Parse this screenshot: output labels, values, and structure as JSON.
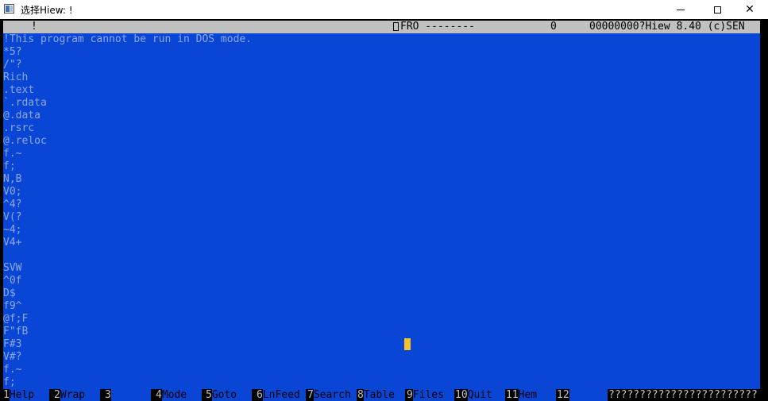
{
  "window": {
    "title": "选择Hiew: !",
    "minimize_glyph": "",
    "maximize_glyph": "",
    "close_glyph": "✕"
  },
  "status": {
    "marker": "!",
    "mode": "FRO --------",
    "offset_col": "0",
    "address_info": "00000000?Hiew 8.40 (c)SEN"
  },
  "content": {
    "lines": [
      "!This program cannot be run in DOS mode.",
      "*5?",
      "/\"?",
      "Rich",
      ".text",
      "`.rdata",
      "@.data",
      ".rsrc",
      "@.reloc",
      "f.~",
      "f;",
      "N,B",
      "V0;",
      "^4?",
      "V(?",
      "~4;",
      "V4+",
      "",
      "SVW",
      "^0f",
      "D$",
      "f9^",
      "@f;F",
      "F\"fB",
      "F#3",
      "V#?",
      "f.~",
      "f;"
    ]
  },
  "fkeys": [
    {
      "num": "1",
      "label": "Help"
    },
    {
      "num": "2",
      "label": "Wrap"
    },
    {
      "num": "3",
      "label": ""
    },
    {
      "num": "4",
      "label": "Mode"
    },
    {
      "num": "5",
      "label": "Goto"
    },
    {
      "num": "6",
      "label": "LnFeed"
    },
    {
      "num": "7",
      "label": "Search"
    },
    {
      "num": "8",
      "label": "Table"
    },
    {
      "num": "9",
      "label": "Files"
    },
    {
      "num": "10",
      "label": "Quit"
    },
    {
      "num": "11",
      "label": "Hem"
    },
    {
      "num": "12",
      "label": ""
    }
  ],
  "fkeys_extra": "????????????????????????",
  "colors": {
    "background_blue": "#0a46d6",
    "text_light_blue": "#8fa8e8",
    "status_gray": "#c0c0c0",
    "cursor_yellow": "#f7c12a"
  }
}
